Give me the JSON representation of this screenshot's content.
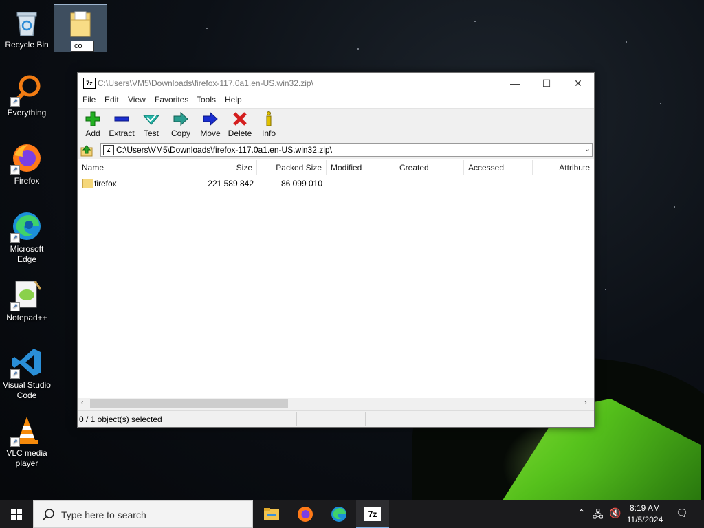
{
  "desktop": {
    "icons": [
      {
        "label": "Recycle Bin"
      },
      {
        "label": "Everything"
      },
      {
        "label": "Firefox"
      },
      {
        "label": "Microsoft Edge"
      },
      {
        "label": "Notepad++"
      },
      {
        "label": "Visual Studio Code"
      },
      {
        "label": "VLC media player"
      }
    ],
    "folder_rename_value": "co"
  },
  "window": {
    "title": "C:\\Users\\VM5\\Downloads\\firefox-117.0a1.en-US.win32.zip\\",
    "app_icon_text": "7z",
    "menu": [
      "File",
      "Edit",
      "View",
      "Favorites",
      "Tools",
      "Help"
    ],
    "toolbar": [
      "Add",
      "Extract",
      "Test",
      "Copy",
      "Move",
      "Delete",
      "Info"
    ],
    "address": "C:\\Users\\VM5\\Downloads\\firefox-117.0a1.en-US.win32.zip\\",
    "columns": [
      "Name",
      "Size",
      "Packed Size",
      "Modified",
      "Created",
      "Accessed",
      "Attribute"
    ],
    "rows": [
      {
        "name": "firefox",
        "size": "221 589 842",
        "packed": "86 099 010"
      }
    ],
    "status": "0 / 1 object(s) selected",
    "controls": {
      "minimize": "—",
      "maximize": "☐",
      "close": "✕"
    }
  },
  "taskbar": {
    "search_placeholder": "Type here to search",
    "time": "8:19 AM",
    "date": "11/5/2024",
    "app_icon_7z": "7z"
  },
  "colors": {
    "add_green": "#22b022",
    "extract_blue": "#1a2ed0",
    "test_teal": "#27b5a8",
    "delete_red": "#d41e1e",
    "info_yellow": "#e0c000"
  }
}
